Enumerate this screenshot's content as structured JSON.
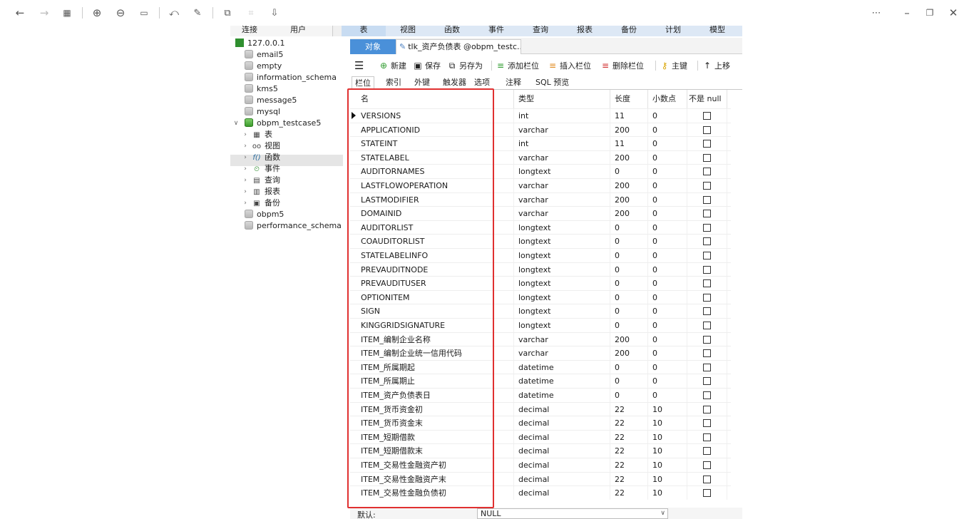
{
  "viewer": {
    "icons": [
      "back-arrow-icon",
      "forward-arrow-icon",
      "grid-icon",
      "zoom-in-icon",
      "zoom-out-icon",
      "actual-size-icon",
      "rotate-icon",
      "edit-icon",
      "copy-icon",
      "crop-icon",
      "download-icon"
    ],
    "window_controls": [
      "more-icon",
      "minimize-icon",
      "restore-icon",
      "close-icon"
    ]
  },
  "menu": {
    "left_tabs": [
      "连接",
      "用户"
    ],
    "right_tabs": [
      "表",
      "视图",
      "函数",
      "事件",
      "查询",
      "报表",
      "备份",
      "计划",
      "模型"
    ]
  },
  "tree": {
    "connection": "127.0.0.1",
    "databases_top": [
      "email5",
      "empty",
      "information_schema",
      "kms5",
      "message5",
      "mysql"
    ],
    "open_database": "obpm_testcase5",
    "children": [
      {
        "glyph": "▦",
        "label": "表"
      },
      {
        "glyph": "oo",
        "label": "视图"
      },
      {
        "glyph": "f()",
        "label": "函数"
      },
      {
        "glyph": "⏲",
        "label": "事件"
      },
      {
        "glyph": "▤",
        "label": "查询"
      },
      {
        "glyph": "▥",
        "label": "报表"
      },
      {
        "glyph": "▣",
        "label": "备份"
      }
    ],
    "databases_bottom": [
      "obpm5",
      "performance_schema"
    ]
  },
  "tabs": {
    "objects": "对象",
    "document": "tlk_资产负债表 @obpm_testc..."
  },
  "toolbar": {
    "new": "新建",
    "save": "保存",
    "save_as": "另存为",
    "add_field": "添加栏位",
    "insert_field": "插入栏位",
    "delete_field": "删除栏位",
    "primary_key": "主键",
    "move_up": "上移"
  },
  "subtabs": [
    "栏位",
    "索引",
    "外键",
    "触发器",
    "选项",
    "注释",
    "SQL 预览"
  ],
  "grid": {
    "headers": {
      "name": "名",
      "type": "类型",
      "length": "长度",
      "decimals": "小数点",
      "not_null": "不是 null"
    },
    "rows": [
      {
        "name": "VERSIONS",
        "type": "int",
        "length": "11",
        "decimals": "0"
      },
      {
        "name": "APPLICATIONID",
        "type": "varchar",
        "length": "200",
        "decimals": "0"
      },
      {
        "name": "STATEINT",
        "type": "int",
        "length": "11",
        "decimals": "0"
      },
      {
        "name": "STATELABEL",
        "type": "varchar",
        "length": "200",
        "decimals": "0"
      },
      {
        "name": "AUDITORNAMES",
        "type": "longtext",
        "length": "0",
        "decimals": "0"
      },
      {
        "name": "LASTFLOWOPERATION",
        "type": "varchar",
        "length": "200",
        "decimals": "0"
      },
      {
        "name": "LASTMODIFIER",
        "type": "varchar",
        "length": "200",
        "decimals": "0"
      },
      {
        "name": "DOMAINID",
        "type": "varchar",
        "length": "200",
        "decimals": "0"
      },
      {
        "name": "AUDITORLIST",
        "type": "longtext",
        "length": "0",
        "decimals": "0"
      },
      {
        "name": "COAUDITORLIST",
        "type": "longtext",
        "length": "0",
        "decimals": "0"
      },
      {
        "name": "STATELABELINFO",
        "type": "longtext",
        "length": "0",
        "decimals": "0"
      },
      {
        "name": "PREVAUDITNODE",
        "type": "longtext",
        "length": "0",
        "decimals": "0"
      },
      {
        "name": "PREVAUDITUSER",
        "type": "longtext",
        "length": "0",
        "decimals": "0"
      },
      {
        "name": "OPTIONITEM",
        "type": "longtext",
        "length": "0",
        "decimals": "0"
      },
      {
        "name": "SIGN",
        "type": "longtext",
        "length": "0",
        "decimals": "0"
      },
      {
        "name": "KINGGRIDSIGNATURE",
        "type": "longtext",
        "length": "0",
        "decimals": "0"
      },
      {
        "name": "ITEM_编制企业名称",
        "type": "varchar",
        "length": "200",
        "decimals": "0"
      },
      {
        "name": "ITEM_编制企业统一信用代码",
        "type": "varchar",
        "length": "200",
        "decimals": "0"
      },
      {
        "name": "ITEM_所属期起",
        "type": "datetime",
        "length": "0",
        "decimals": "0"
      },
      {
        "name": "ITEM_所属期止",
        "type": "datetime",
        "length": "0",
        "decimals": "0"
      },
      {
        "name": "ITEM_资产负债表日",
        "type": "datetime",
        "length": "0",
        "decimals": "0"
      },
      {
        "name": "ITEM_货币资金初",
        "type": "decimal",
        "length": "22",
        "decimals": "10"
      },
      {
        "name": "ITEM_货币资金末",
        "type": "decimal",
        "length": "22",
        "decimals": "10"
      },
      {
        "name": "ITEM_短期借款",
        "type": "decimal",
        "length": "22",
        "decimals": "10"
      },
      {
        "name": "ITEM_短期借款末",
        "type": "decimal",
        "length": "22",
        "decimals": "10"
      },
      {
        "name": "ITEM_交易性金融资产初",
        "type": "decimal",
        "length": "22",
        "decimals": "10"
      },
      {
        "name": "ITEM_交易性金融资产末",
        "type": "decimal",
        "length": "22",
        "decimals": "10"
      },
      {
        "name": "ITEM_交易性金融负债初",
        "type": "decimal",
        "length": "22",
        "decimals": "10"
      }
    ]
  },
  "bottom": {
    "default_label": "默认:",
    "default_value": "NULL"
  },
  "colors": {
    "highlight_box": "#e03030",
    "active_tab": "#4a90d9"
  }
}
